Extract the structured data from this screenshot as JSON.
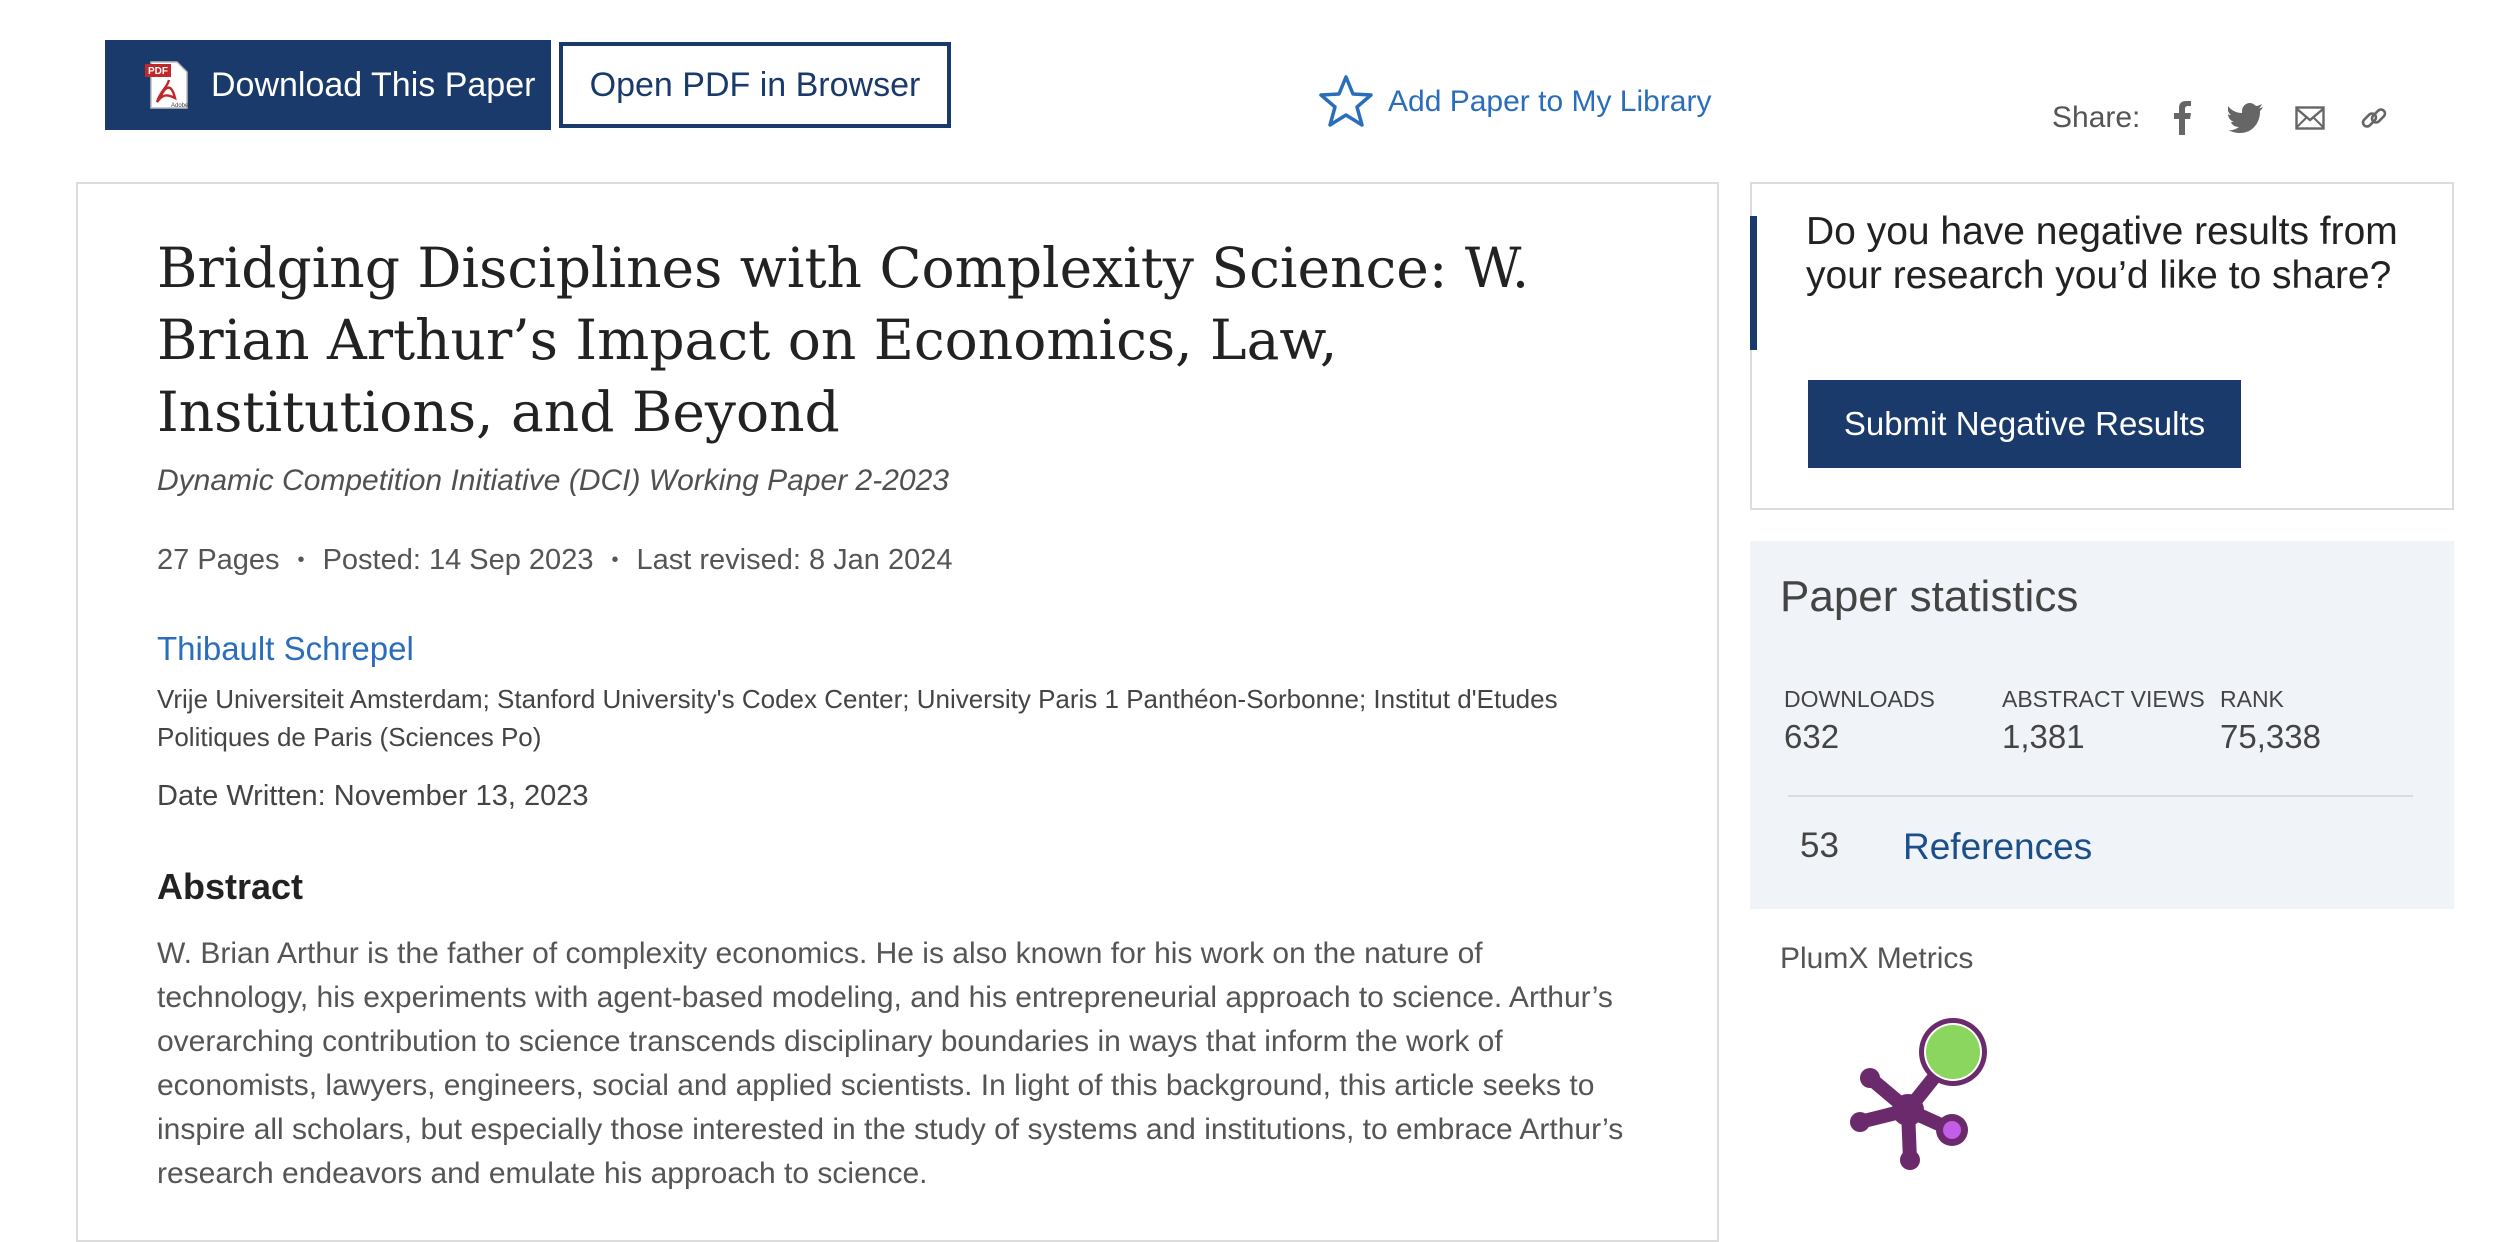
{
  "toolbar": {
    "download_label": "Download This Paper",
    "open_pdf_label": "Open PDF in Browser",
    "add_library_label": "Add Paper to My Library",
    "share_label": "Share:"
  },
  "paper": {
    "title": "Bridging Disciplines with Complexity Science: W. Brian Arthur’s Impact on Economics, Law, Institutions, and Beyond",
    "series": "Dynamic Competition Initiative (DCI) Working Paper 2-2023",
    "pages": "27 Pages",
    "posted": "Posted: 14 Sep 2023",
    "last_revised": "Last revised: 8 Jan 2024",
    "author": "Thibault Schrepel",
    "affiliation": "Vrije Universiteit Amsterdam; Stanford University's Codex Center; University Paris 1 Panthéon-Sorbonne; Institut d'Etudes Politiques de Paris (Sciences Po)",
    "date_written": "Date Written: November 13, 2023",
    "abstract_heading": "Abstract",
    "abstract": "W. Brian Arthur is the father of complexity economics. He is also known for his work on the nature of technology, his experiments with agent-based modeling, and his entrepreneurial approach to science. Arthur’s overarching contribution to science transcends disciplinary boundaries in ways that inform the work of economists, lawyers, engineers, social and applied scientists. In light of this background, this article seeks to inspire all scholars, but especially those interested in the study of systems and institutions, to embrace Arthur’s research endeavors and emulate his approach to science."
  },
  "negative_results": {
    "question": "Do you have negative results from your research you’d like to share?",
    "button_label": "Submit Negative Results"
  },
  "stats": {
    "title": "Paper statistics",
    "downloads_label": "DOWNLOADS",
    "downloads_value": "632",
    "views_label": "ABSTRACT VIEWS",
    "views_value": "1,381",
    "rank_label": "RANK",
    "rank_value": "75,338",
    "references_count": "53",
    "references_label": "References"
  },
  "plumx": {
    "title": "PlumX Metrics"
  },
  "colors": {
    "brand_navy": "#1a3a6b",
    "link_blue": "#2a6ebb",
    "plumx_purple": "#6b2a6b",
    "plumx_green": "#8ad65e",
    "plumx_magenta": "#c35ee8"
  }
}
